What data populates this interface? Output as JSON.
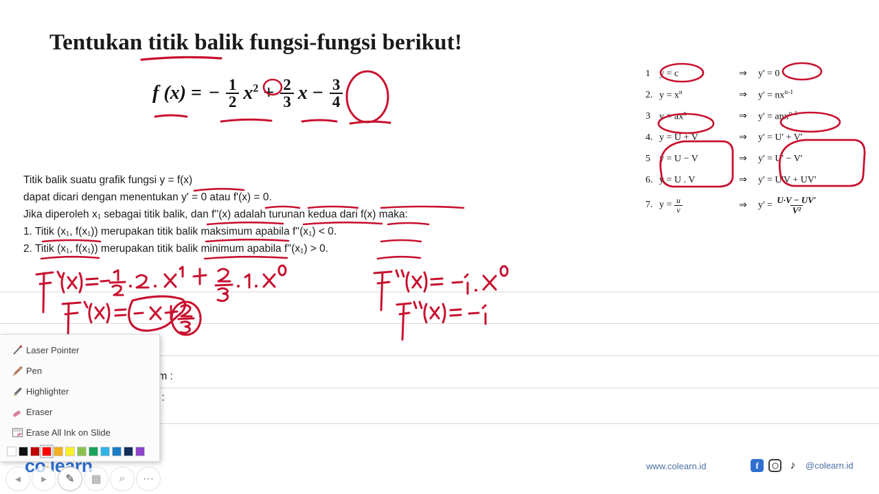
{
  "slide": {
    "title": "Tentukan titik balik fungsi-fungsi berikut!",
    "formula": {
      "lhs": "f (x)",
      "eq": "=",
      "minus": "−",
      "frac1_num": "1",
      "frac1_den": "2",
      "x_base": "x",
      "x_exp": "2",
      "plus": "+",
      "frac2_num": "2",
      "frac2_den": "3",
      "x2": "x",
      "minus2": "−",
      "frac3_num": "3",
      "frac3_den": "4"
    },
    "body_lines": [
      "Titik balik suatu grafik fungsi y = f(x)",
      "dapat dicari  dengan menentukan y' = 0 atau f'(x) = 0.",
      "Jika diperoleh x₁ sebagai titik balik, dan f''(x) adalah turunan kedua dari f(x) maka:",
      "1.  Titik (x₁, f(x₁)) merupakan titik balik maksimum apabila f''(x₁) < 0.",
      "2.  Titik (x₁, f(x₁)) merupakan titik balik minimum apabila f''(x₁) > 0."
    ],
    "answer_labels": [
      "Titik balik maksimum :",
      "Titik balik minimum  :"
    ]
  },
  "rules_table": {
    "rows": [
      {
        "num": "1",
        "left": "y = c",
        "arrow": "⇒",
        "right": "y' = 0"
      },
      {
        "num": "2.",
        "left": "y = x",
        "left_sup": "n",
        "arrow": "⇒",
        "right": "y' = nx",
        "right_sup": "n-1"
      },
      {
        "num": "3",
        "left": "y = ax",
        "left_sup": "n",
        "arrow": "⇒",
        "right": "y' = anx",
        "right_sup": "n-1"
      },
      {
        "num": "4.",
        "left": "y = U + V",
        "arrow": "⇒",
        "right": "y' = U' + V'"
      },
      {
        "num": "5",
        "left": "y = U − V",
        "arrow": "⇒",
        "right": "y' = U' − V'"
      },
      {
        "num": "6.",
        "left": "y = U . V",
        "arrow": "⇒",
        "right": "y' = U'V + UV'"
      },
      {
        "num": "7.",
        "left_prefix": "y =",
        "left_frac_num": "u",
        "left_frac_den": "v",
        "arrow": "⇒",
        "right_prefix": "y' =",
        "right_frac_num": "U·V − UV′",
        "right_frac_den": "V²"
      }
    ]
  },
  "handwriting": {
    "line1": "f '(x) = − 1/2 . 2 . x¹ + 2/3 . 1 . x⁰",
    "line2": "f '(x) = − x + 2/3",
    "line3": "f ''(x) = − 1 . x⁰",
    "line4": "f ''(x) = − 1",
    "ink_color": "#c8102e"
  },
  "pen_menu": {
    "items": [
      {
        "icon": "laser-pointer-icon",
        "label": "Laser Pointer"
      },
      {
        "icon": "pen-icon",
        "label": "Pen"
      },
      {
        "icon": "highlighter-icon",
        "label": "Highlighter"
      },
      {
        "icon": "eraser-icon",
        "label": "Eraser"
      },
      {
        "icon": "erase-all-ink-icon",
        "label": "Erase All Ink on Slide"
      }
    ],
    "colors": [
      "#ffffff",
      "#111111",
      "#c00000",
      "#ff0000",
      "#f2b01e",
      "#fbf028",
      "#8cc152",
      "#1aa35a",
      "#2eb4e6",
      "#1b7ec4",
      "#12305e",
      "#8e44c9"
    ],
    "selected_color_index": 3
  },
  "bottom_toolbar": {
    "buttons": [
      {
        "name": "previous-slide-button",
        "glyph": "◂",
        "active": false
      },
      {
        "name": "next-slide-button",
        "glyph": "▸",
        "active": false
      },
      {
        "name": "pen-tool-button",
        "glyph": "✎",
        "active": true
      },
      {
        "name": "slide-grid-button",
        "glyph": "▦",
        "active": false
      },
      {
        "name": "zoom-button",
        "glyph": "⌕",
        "active": false
      },
      {
        "name": "more-options-button",
        "glyph": "⋯",
        "active": false
      }
    ]
  },
  "branding": {
    "logo_text_1": "co",
    "logo_dot": "·",
    "logo_text_2": "learn",
    "website": "www.colearn.id",
    "handle": "@colearn.id",
    "facebook_glyph": "f",
    "tiktok_glyph": "♪"
  }
}
